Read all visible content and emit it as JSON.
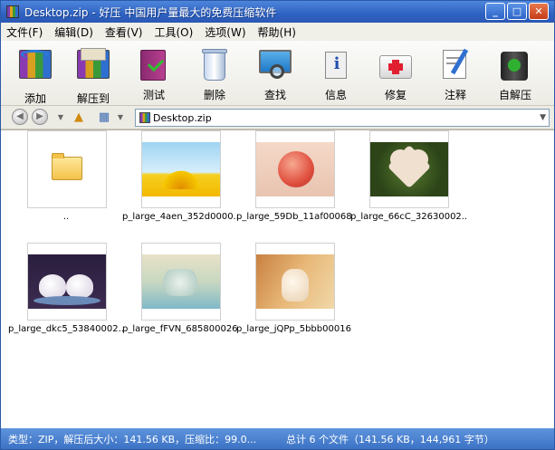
{
  "window": {
    "title": "Desktop.zip - 好压 中国用户量最大的免费压缩软件"
  },
  "window_buttons": {
    "minimize": "_",
    "maximize": "□",
    "close": "✕"
  },
  "menu": [
    "文件(F)",
    "编辑(D)",
    "查看(V)",
    "工具(O)",
    "选项(W)",
    "帮助(H)"
  ],
  "toolbar": {
    "add": "添加",
    "extract": "解压到",
    "test": "测试",
    "delete": "删除",
    "find": "查找",
    "info": "信息",
    "repair": "修复",
    "comment": "注释",
    "sfx": "自解压"
  },
  "address": {
    "path": "Desktop.zip"
  },
  "files": [
    {
      "name": "..",
      "kind": "folder"
    },
    {
      "name": "p_large_4aen_352d0000...",
      "kind": "image",
      "theme": "sunflower"
    },
    {
      "name": "p_large_59Db_11af00068...",
      "kind": "image",
      "theme": "apple"
    },
    {
      "name": "p_large_66cC_32630002...",
      "kind": "image",
      "theme": "heart"
    },
    {
      "name": "p_large_dkc5_53840002...",
      "kind": "image",
      "theme": "cats"
    },
    {
      "name": "p_large_fFVN_685800026...",
      "kind": "image",
      "theme": "hands"
    },
    {
      "name": "p_large_jQPp_5bbb00016...",
      "kind": "image",
      "theme": "glove"
    }
  ],
  "status": {
    "left": "类型：ZIP，解压后大小：141.56 KB，压缩比：99.0...",
    "right": "总计 6 个文件（141.56 KB，144,961 字节）"
  },
  "colors": {
    "titlebar": "#2f62c2",
    "statusbar": "#3c72c4"
  }
}
